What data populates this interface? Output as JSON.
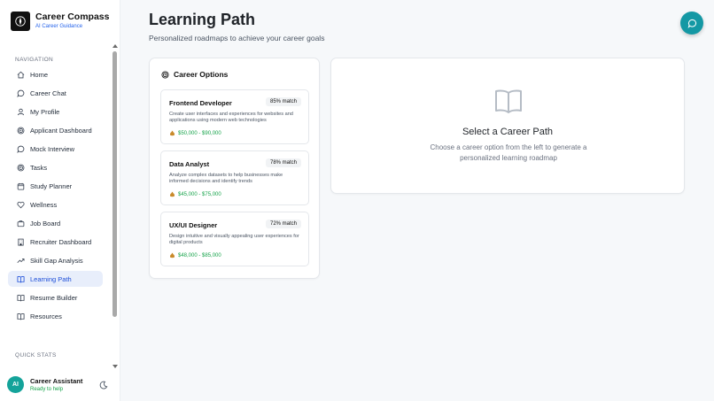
{
  "brand": {
    "title": "Career Compass",
    "subtitle": "AI Career Guidance"
  },
  "sidebar": {
    "heading": "NAVIGATION",
    "items": [
      {
        "label": "Home",
        "icon": "home-icon"
      },
      {
        "label": "Career Chat",
        "icon": "chat-icon"
      },
      {
        "label": "My Profile",
        "icon": "user-icon"
      },
      {
        "label": "Applicant Dashboard",
        "icon": "target-icon"
      },
      {
        "label": "Mock Interview",
        "icon": "chat-icon"
      },
      {
        "label": "Tasks",
        "icon": "target-icon"
      },
      {
        "label": "Study Planner",
        "icon": "calendar-icon"
      },
      {
        "label": "Wellness",
        "icon": "heart-icon"
      },
      {
        "label": "Job Board",
        "icon": "briefcase-icon"
      },
      {
        "label": "Recruiter Dashboard",
        "icon": "building-icon"
      },
      {
        "label": "Skill Gap Analysis",
        "icon": "trending-up-icon"
      },
      {
        "label": "Learning Path",
        "icon": "book-icon",
        "active": true
      },
      {
        "label": "Resume Builder",
        "icon": "book-icon"
      },
      {
        "label": "Resources",
        "icon": "book-icon"
      }
    ],
    "quick_stats": "QUICK STATS",
    "assistant": {
      "avatar": "AI",
      "name": "Career Assistant",
      "status": "Ready to help"
    }
  },
  "page": {
    "title": "Learning Path",
    "subtitle": "Personalized roadmaps to achieve your career goals"
  },
  "career_options": {
    "heading": "Career Options",
    "items": [
      {
        "title": "Frontend Developer",
        "match": "85% match",
        "description": "Create user interfaces and experiences for websites and applications using modern web technologies",
        "salary": "$50,000 - $90,000"
      },
      {
        "title": "Data Analyst",
        "match": "78% match",
        "description": "Analyze complex datasets to help businesses make informed decisions and identify trends",
        "salary": "$45,000 - $75,000"
      },
      {
        "title": "UX/UI Designer",
        "match": "72% match",
        "description": "Design intuitive and visually appealing user experiences for digital products",
        "salary": "$48,000 - $85,000"
      }
    ]
  },
  "detail": {
    "title": "Select a Career Path",
    "description": "Choose a career option from the left to generate a personalized learning roadmap"
  },
  "colors": {
    "accent": "#1d4ed8",
    "active_bg": "#e8eefb",
    "teal": "#1498a4",
    "salary": "#16a34a"
  }
}
